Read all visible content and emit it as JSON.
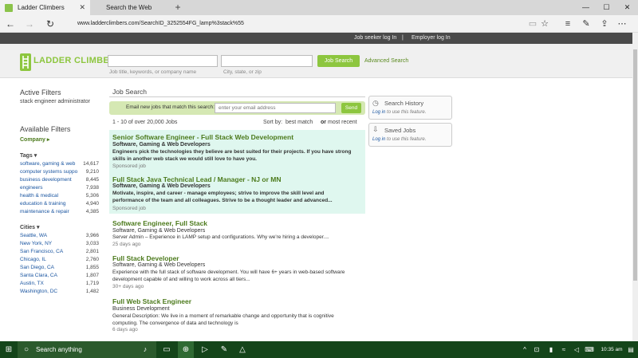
{
  "browser": {
    "tabs": [
      {
        "label": "Ladder Climbers",
        "close": "✕"
      },
      {
        "label": "Search the Web"
      }
    ],
    "new_tab": "+",
    "url": "www.ladderclimbers.com/SearchID_3252554FG_lamp%3stack%55"
  },
  "site": {
    "top_links": [
      "Job seeker log In",
      "|",
      "Employer log In"
    ],
    "logo": "LADDER CLIMBERS",
    "search": {
      "keywords_placeholder": "",
      "keywords_hint": "Job title, keywords, or company name",
      "location_placeholder": "",
      "location_hint": "City, state, or zip",
      "button": "Job Search",
      "advanced": "Advanced Search"
    }
  },
  "sidebar": {
    "active_title": "Active Filters",
    "active_value": "stack engineer administrator",
    "available_title": "Available Filters",
    "company_label": "Company",
    "tags_label": "Tags",
    "tags": [
      {
        "label": "software, gaming & web",
        "count": "14,617"
      },
      {
        "label": "computer systems suppo",
        "count": "9,210"
      },
      {
        "label": "business development",
        "count": "8,445"
      },
      {
        "label": "engineers",
        "count": "7,938"
      },
      {
        "label": "health & medical",
        "count": "5,306"
      },
      {
        "label": "education & training",
        "count": "4,940"
      },
      {
        "label": "maintenance & repair",
        "count": "4,385"
      }
    ],
    "cities_label": "Cities",
    "cities": [
      {
        "label": "Seattle, WA",
        "count": "3,966"
      },
      {
        "label": "New York, NY",
        "count": "3,033"
      },
      {
        "label": "San Francisco, CA",
        "count": "2,801"
      },
      {
        "label": "Chicago, IL",
        "count": "2,760"
      },
      {
        "label": "San Diego, CA",
        "count": "1,855"
      },
      {
        "label": "Santa Clara, CA",
        "count": "1,807"
      },
      {
        "label": "Austin, TX",
        "count": "1,719"
      },
      {
        "label": "Washington, DC",
        "count": "1,482"
      }
    ]
  },
  "main": {
    "title": "Job Search",
    "email_label": "Email new jobs that match this search:",
    "email_placeholder": "enter your email address",
    "send": "Send",
    "results_count": "1 - 10 of over 20,000 Jobs",
    "sort_label": "Sort by:",
    "sort_best": "best match",
    "sort_or": "or",
    "sort_recent": "most recent",
    "jobs": [
      {
        "title": "Senior Software Engineer - Full Stack Web Development",
        "company": "Software, Gaming & Web Developers",
        "desc": "Engineers pick the technologies they believe are best suited for their projects. If you have strong skills in another web stack we would still love to have you.",
        "meta": "Sponsored job"
      },
      {
        "title": "Full Stack Java Technical Lead / Manager - NJ or MN",
        "company": "Software, Gaming & Web Developers",
        "desc": "Motivate, inspire, and career - manage employees; strive to improve the skill level and performance of the team and all colleagues. Strive to be a thought leader and advanced...",
        "meta": "Sponsored job"
      },
      {
        "title": "Software Engineer, Full Stack",
        "company": "Software, Gaming & Web Developers",
        "desc": "Server Admin – Experience in LAMP setup and configurations. Why we're hiring a developer....",
        "meta": "25 days ago"
      },
      {
        "title": "Full Stack Developer",
        "company": "Software, Gaming & Web Developers",
        "desc": "Experience with the full stack of software development. You will have 6+ years in web-based software development capable of and willing to work across all tiers...",
        "meta": "30+ days ago"
      },
      {
        "title": "Full Web Stack Engineer",
        "company": "Business Development",
        "desc": "General Description: We live in a moment of remarkable change and opportunity that is cognitive computing. The convergence of data and technology is",
        "meta": "6 days ago"
      }
    ]
  },
  "right": {
    "history_title": "Search History",
    "saved_title": "Saved Jobs",
    "login_link": "Log in",
    "login_rest": " to use this feature."
  },
  "taskbar": {
    "search_placeholder": "Search anything",
    "time": "10:35 am"
  }
}
